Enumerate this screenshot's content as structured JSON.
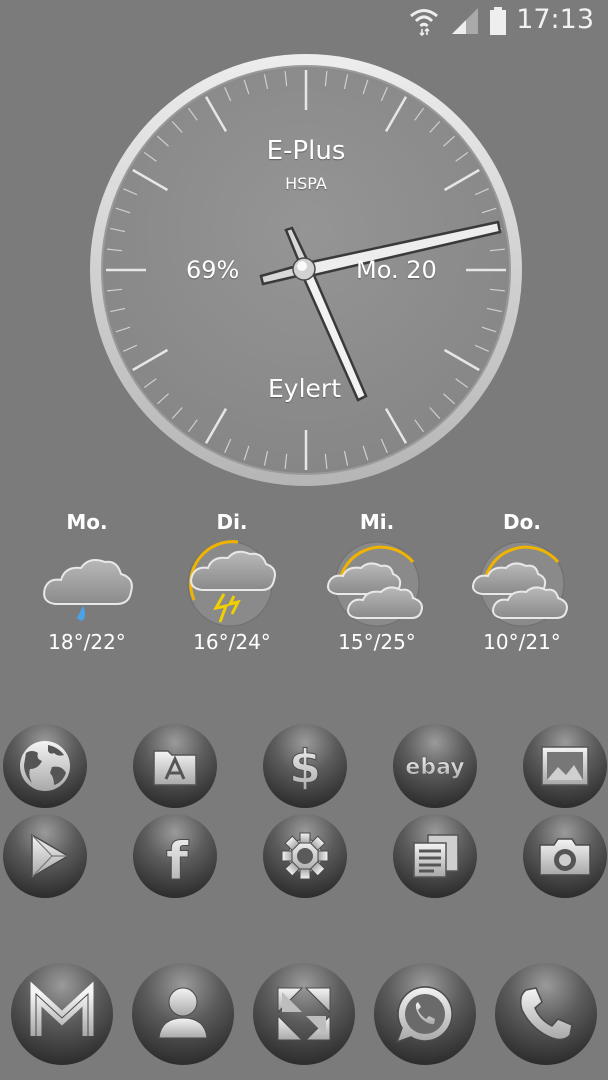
{
  "status_bar": {
    "time": "17:13",
    "icons": [
      "wifi-icon",
      "cell-signal-icon",
      "battery-icon"
    ]
  },
  "clock_widget": {
    "carrier": "E-Plus",
    "network_type": "HSPA",
    "battery": "69%",
    "date": "Mo. 20",
    "location": "Eylert"
  },
  "weather": {
    "days": [
      {
        "day": "Mo.",
        "temps": "18°/22°",
        "icon": "rain-cloud-icon"
      },
      {
        "day": "Di.",
        "temps": "16°/24°",
        "icon": "thunderstorm-icon"
      },
      {
        "day": "Mi.",
        "temps": "15°/25°",
        "icon": "partly-cloudy-icon"
      },
      {
        "day": "Do.",
        "temps": "10°/21°",
        "icon": "partly-cloudy-icon"
      }
    ]
  },
  "apps": {
    "row1": [
      "globe-icon",
      "folder-app-icon",
      "dollar-icon",
      "ebay-icon",
      "gallery-icon"
    ],
    "row2": [
      "play-store-icon",
      "facebook-icon",
      "settings-gear-icon",
      "news-icon",
      "camera-icon"
    ],
    "ebay_label": "ebay",
    "facebook_label": "f"
  },
  "dock": {
    "apps": [
      "gmail-icon",
      "contacts-icon",
      "app-drawer-icon",
      "whatsapp-icon",
      "phone-icon"
    ]
  },
  "colors": {
    "background": "#7b7b7b",
    "clock_face": "#8e8e8e",
    "icon_base": "#3e3e3e",
    "sun_accent": "#f0b400",
    "rain_accent": "#4aa3e8"
  }
}
